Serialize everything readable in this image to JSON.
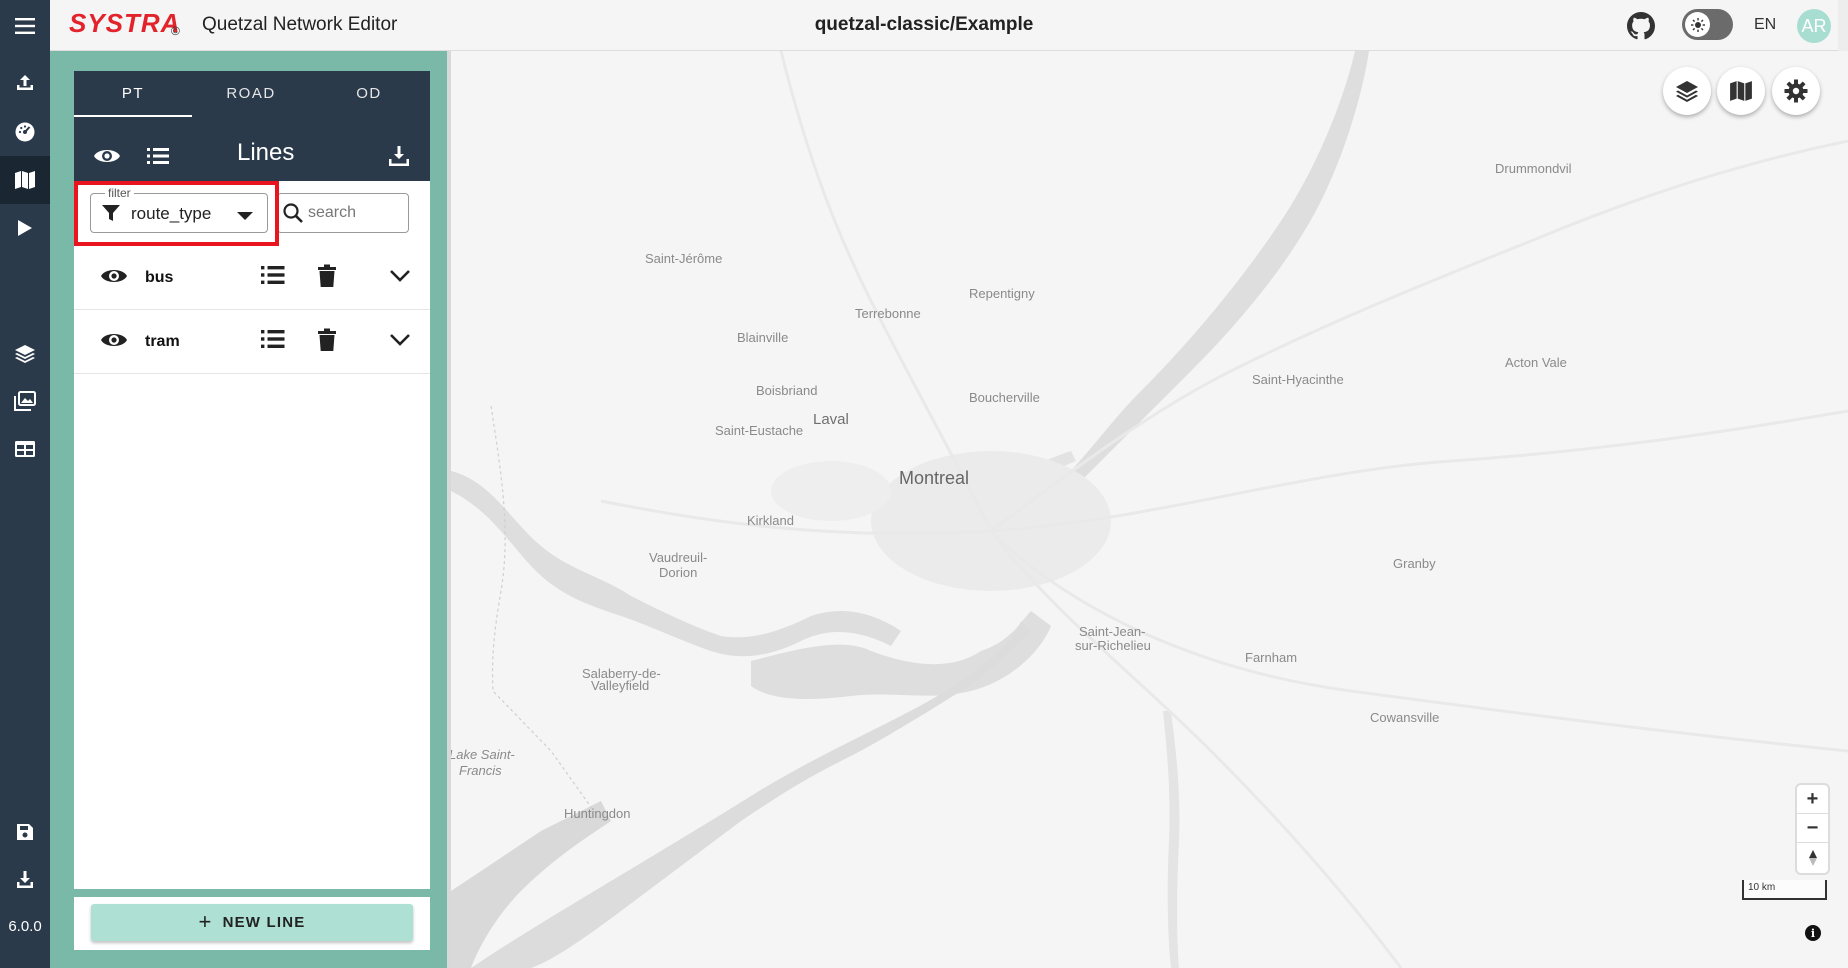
{
  "app": {
    "brand": "SYSTRA",
    "brand_mark": "©",
    "title": "Quetzal Network Editor",
    "project": "quetzal-classic/Example",
    "language": "EN",
    "user_initials": "AR",
    "version": "6.0.0"
  },
  "panel": {
    "tabs": [
      {
        "label": "PT",
        "active": true
      },
      {
        "label": "ROAD",
        "active": false
      },
      {
        "label": "OD",
        "active": false
      }
    ],
    "title": "Lines",
    "filter": {
      "legend": "filter",
      "value": "route_type"
    },
    "search": {
      "placeholder": "search"
    },
    "groups": [
      {
        "name": "bus"
      },
      {
        "name": "tram"
      }
    ],
    "new_line_label": "NEW LINE"
  },
  "map": {
    "cities": [
      {
        "name": "Drummondvil",
        "size": "small"
      },
      {
        "name": "Saint-Jérôme",
        "size": "small"
      },
      {
        "name": "Repentigny",
        "size": "small"
      },
      {
        "name": "Terrebonne",
        "size": "small"
      },
      {
        "name": "Blainville",
        "size": "small"
      },
      {
        "name": "Acton Vale",
        "size": "small"
      },
      {
        "name": "Saint-Hyacinthe",
        "size": "small"
      },
      {
        "name": "Boisbriand",
        "size": "small"
      },
      {
        "name": "Boucherville",
        "size": "small"
      },
      {
        "name": "Laval",
        "size": "mid"
      },
      {
        "name": "Saint-Eustache",
        "size": "small"
      },
      {
        "name": "Montreal",
        "size": "big"
      },
      {
        "name": "Kirkland",
        "size": "small"
      },
      {
        "name": "Vaudreuil-",
        "size": "small"
      },
      {
        "name": "Dorion",
        "size": "small"
      },
      {
        "name": "Granby",
        "size": "small"
      },
      {
        "name": "Saint-Jean-",
        "size": "small"
      },
      {
        "name": "sur-Richelieu",
        "size": "small"
      },
      {
        "name": "Farnham",
        "size": "small"
      },
      {
        "name": "Salaberry-de-",
        "size": "small"
      },
      {
        "name": "Valleyfield",
        "size": "small"
      },
      {
        "name": "Cowansville",
        "size": "small"
      },
      {
        "name": "Lake Saint-",
        "size": "small"
      },
      {
        "name": "Francis",
        "size": "small"
      },
      {
        "name": "Huntingdon",
        "size": "small"
      }
    ],
    "scale_label": "10 km",
    "zoom_in": "+",
    "zoom_out": "−",
    "info": "i"
  },
  "colors": {
    "rail": "#2b3a4a",
    "panel_accent": "#7ab9a7",
    "brand_red": "#e3232b",
    "new_line_button": "#aee0d3",
    "highlight": "#e8141e"
  }
}
